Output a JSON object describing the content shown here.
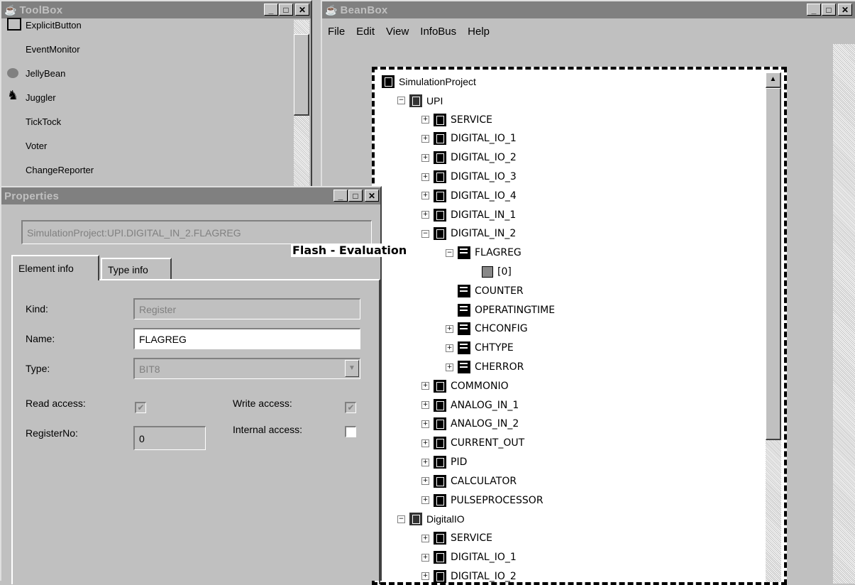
{
  "toolbox": {
    "title": "ToolBox",
    "items": [
      "ExplicitButton",
      "EventMonitor",
      "JellyBean",
      "Juggler",
      "TickTock",
      "Voter",
      "ChangeReporter"
    ]
  },
  "beanbox": {
    "title": "BeanBox",
    "menu": [
      "File",
      "Edit",
      "View",
      "InfoBus",
      "Help"
    ]
  },
  "tree": {
    "root": "SimulationProject",
    "nodes": [
      "UPI",
      "SERVICE",
      "DIGITAL_IO_1",
      "DIGITAL_IO_2",
      "DIGITAL_IO_3",
      "DIGITAL_IO_4",
      "DIGITAL_IN_1",
      "DIGITAL_IN_2",
      "FLAGREG",
      "[0]",
      "COUNTER",
      "OPERATINGTIME",
      "CHCONFIG",
      "CHTYPE",
      "CHERROR",
      "COMMONIO",
      "ANALOG_IN_1",
      "ANALOG_IN_2",
      "CURRENT_OUT",
      "PID",
      "CALCULATOR",
      "PULSEPROCESSOR",
      "DigitalIO",
      "SERVICE",
      "DIGITAL_IO_1",
      "DIGITAL_IO_2"
    ]
  },
  "flash_label": "Flash - Evaluation",
  "properties": {
    "title": "Properties",
    "path": "SimulationProject:UPI.DIGITAL_IN_2.FLAGREG",
    "tabs": [
      "Element info",
      "Type info"
    ],
    "kind_label": "Kind:",
    "kind_value": "Register",
    "name_label": "Name:",
    "name_value": "FLAGREG",
    "type_label": "Type:",
    "type_value": "BIT8",
    "read_label": "Read access:",
    "write_label": "Write access:",
    "regno_label": "RegisterNo:",
    "regno_value": "0",
    "internal_label": "Internal access:",
    "read_checked": true,
    "write_checked": true,
    "internal_checked": false
  }
}
